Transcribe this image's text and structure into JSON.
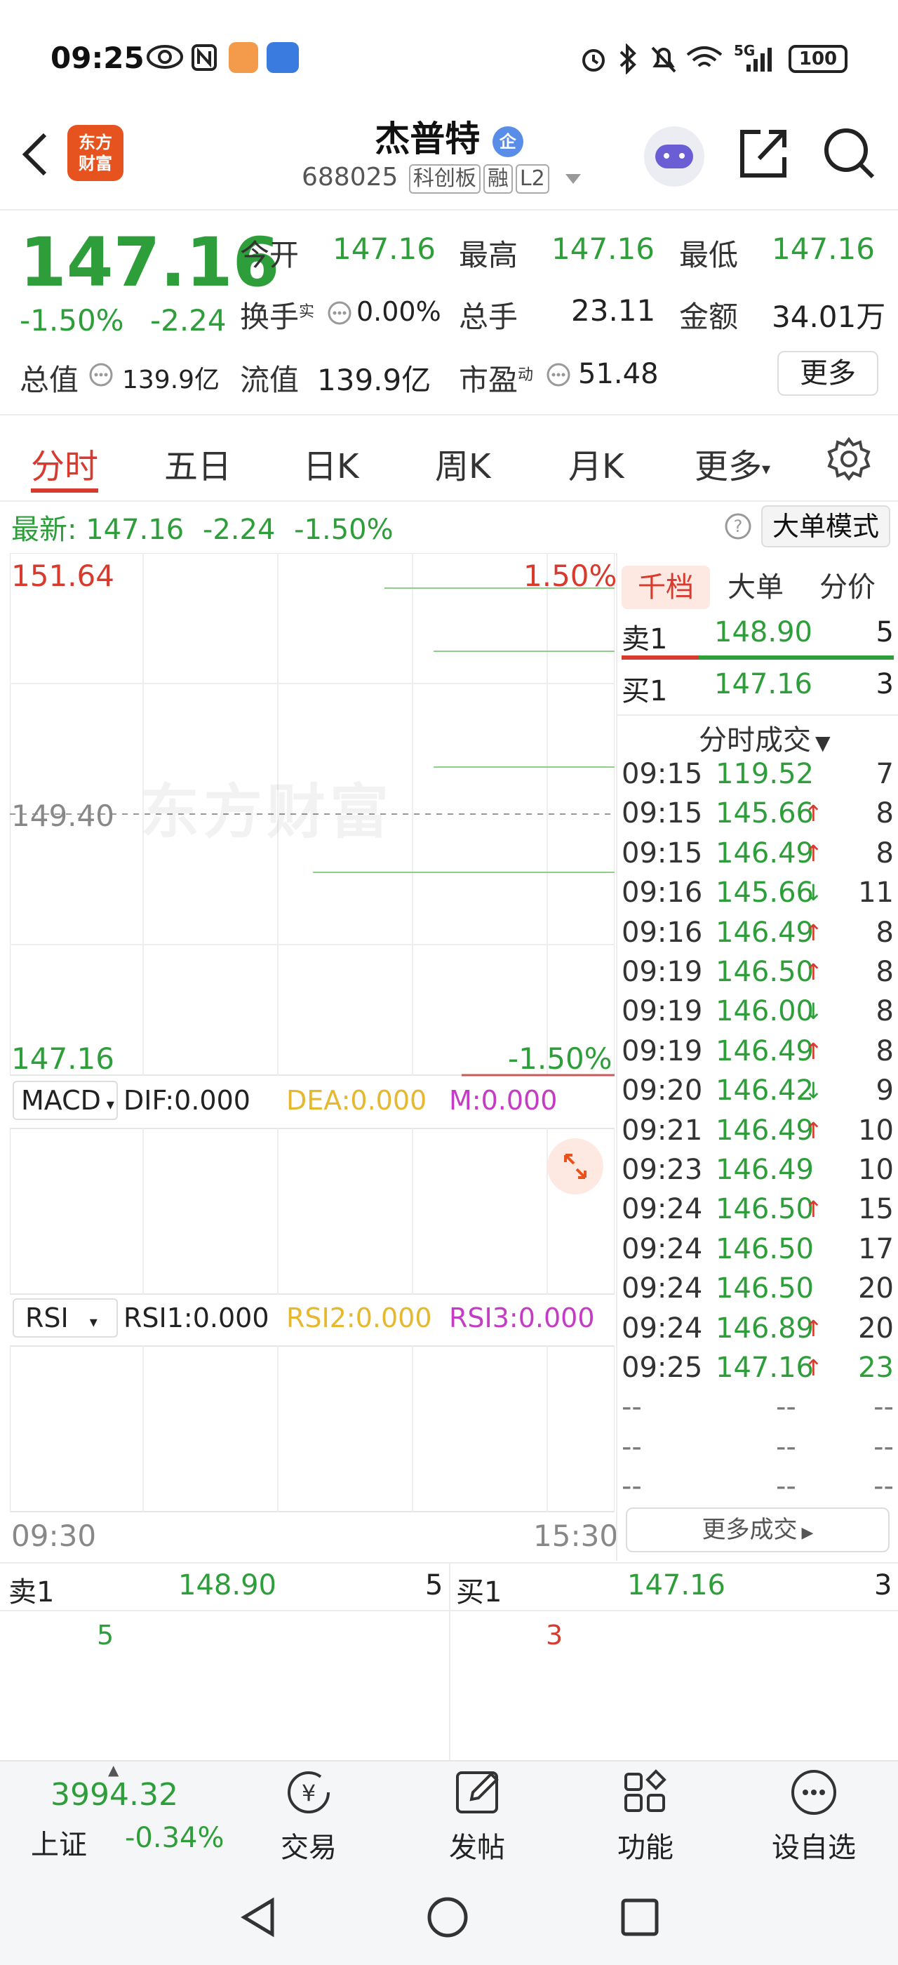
{
  "status_bar": {
    "time": "09:25",
    "battery": "100",
    "network": "5G",
    "left_icons": [
      "eye-icon",
      "nfc-icon",
      "shield-app-icon",
      "chart-app-icon"
    ],
    "right_icons": [
      "alarm-icon",
      "bluetooth-icon",
      "mute-icon",
      "wifi-icon",
      "signal-icon",
      "battery-icon"
    ]
  },
  "header": {
    "back_icon": "chevron-left-icon",
    "logo_line1": "东方",
    "logo_line2": "财富",
    "stock_name": "杰普特",
    "name_badge": "企",
    "stock_code": "688025",
    "tags": [
      "科创板",
      "融",
      "L2"
    ],
    "action_icons": [
      "robot-avatar-icon",
      "share-icon",
      "search-icon"
    ]
  },
  "quote": {
    "price": "147.16",
    "change_pct": "-1.50%",
    "change_abs": "-2.24",
    "row1": [
      {
        "label": "今开",
        "value": "147.16"
      },
      {
        "label": "最高",
        "value": "147.16"
      },
      {
        "label": "最低",
        "value": "147.16"
      }
    ],
    "row2": [
      {
        "label": "换手",
        "sup": "实",
        "value": "0.00%"
      },
      {
        "label": "总手",
        "value": "23.11"
      },
      {
        "label": "金额",
        "value": "34.01万"
      }
    ],
    "row3": [
      {
        "label": "总值",
        "value": "139.9亿"
      },
      {
        "label": "流值",
        "value": "139.9亿"
      },
      {
        "label": "市盈",
        "sup": "动",
        "value": "51.48"
      }
    ],
    "more_label": "更多"
  },
  "tabs": {
    "items": [
      "分时",
      "五日",
      "日K",
      "周K",
      "月K",
      "更多"
    ],
    "active": "分时",
    "settings_icon": "gear-icon"
  },
  "latest": {
    "label": "最新:",
    "price": "147.16",
    "change": "-2.24",
    "pct": "-1.50%",
    "bigmode_label": "大单模式",
    "help_icon": "question-icon"
  },
  "chart": {
    "y_top": "151.64",
    "y_mid": "149.40",
    "y_bottom": "147.16",
    "pct_top": "1.50%",
    "pct_bottom": "-1.50%",
    "x_start": "09:30",
    "x_end": "15:30",
    "watermark": "东方财富",
    "macd": {
      "select": "MACD",
      "dif": "DIF:0.000",
      "dea": "DEA:0.000",
      "m": "M:0.000"
    },
    "rsi": {
      "select": "RSI",
      "rsi1": "RSI1:0.000",
      "rsi2": "RSI2:0.000",
      "rsi3": "RSI3:0.000"
    }
  },
  "right_panel": {
    "tabs": [
      "千档",
      "大单",
      "分价"
    ],
    "active_tab": "千档",
    "sell1": {
      "label": "卖1",
      "price": "148.90",
      "qty": "5"
    },
    "buy1": {
      "label": "买1",
      "price": "147.16",
      "qty": "3"
    },
    "trades_title": "分时成交",
    "trades": [
      {
        "time": "09:15",
        "price": "119.52",
        "dir": "",
        "qty": "7"
      },
      {
        "time": "09:15",
        "price": "145.66",
        "dir": "up",
        "qty": "8"
      },
      {
        "time": "09:15",
        "price": "146.49",
        "dir": "up",
        "qty": "8"
      },
      {
        "time": "09:16",
        "price": "145.66",
        "dir": "down",
        "qty": "11"
      },
      {
        "time": "09:16",
        "price": "146.49",
        "dir": "up",
        "qty": "8"
      },
      {
        "time": "09:19",
        "price": "146.50",
        "dir": "up",
        "qty": "8"
      },
      {
        "time": "09:19",
        "price": "146.00",
        "dir": "down",
        "qty": "8"
      },
      {
        "time": "09:19",
        "price": "146.49",
        "dir": "up",
        "qty": "8"
      },
      {
        "time": "09:20",
        "price": "146.42",
        "dir": "down",
        "qty": "9"
      },
      {
        "time": "09:21",
        "price": "146.49",
        "dir": "up",
        "qty": "10"
      },
      {
        "time": "09:23",
        "price": "146.49",
        "dir": "",
        "qty": "10"
      },
      {
        "time": "09:24",
        "price": "146.50",
        "dir": "up",
        "qty": "15"
      },
      {
        "time": "09:24",
        "price": "146.50",
        "dir": "",
        "qty": "17"
      },
      {
        "time": "09:24",
        "price": "146.50",
        "dir": "",
        "qty": "20"
      },
      {
        "time": "09:24",
        "price": "146.89",
        "dir": "up",
        "qty": "20"
      },
      {
        "time": "09:25",
        "price": "147.16",
        "dir": "up",
        "qty": "23",
        "highlight": true
      },
      {
        "time": "--",
        "price": "--",
        "dir": "",
        "qty": "--"
      },
      {
        "time": "--",
        "price": "--",
        "dir": "",
        "qty": "--"
      },
      {
        "time": "--",
        "price": "--",
        "dir": "",
        "qty": "--"
      }
    ],
    "more_trades_label": "更多成交"
  },
  "order_book": {
    "sell_label": "卖1",
    "sell_price": "148.90",
    "sell_qty": "5",
    "sell_sub": "5",
    "buy_label": "买1",
    "buy_price": "147.16",
    "buy_qty": "3",
    "buy_sub": "3"
  },
  "bottom_nav": {
    "index_value": "3994.32",
    "index_name": "上证",
    "index_change": "-0.34%",
    "items": [
      {
        "label": "交易",
        "icon": "yuan-cycle-icon"
      },
      {
        "label": "发帖",
        "icon": "edit-icon"
      },
      {
        "label": "功能",
        "icon": "grid-icon"
      },
      {
        "label": "设自选",
        "icon": "more-circle-icon"
      }
    ]
  },
  "system_nav": {
    "icons": [
      "back-triangle-icon",
      "home-circle-icon",
      "recents-square-icon"
    ]
  },
  "colors": {
    "down_green": "#2e9e3a",
    "up_red": "#d83a2e",
    "brand_orange": "#e6531f"
  }
}
